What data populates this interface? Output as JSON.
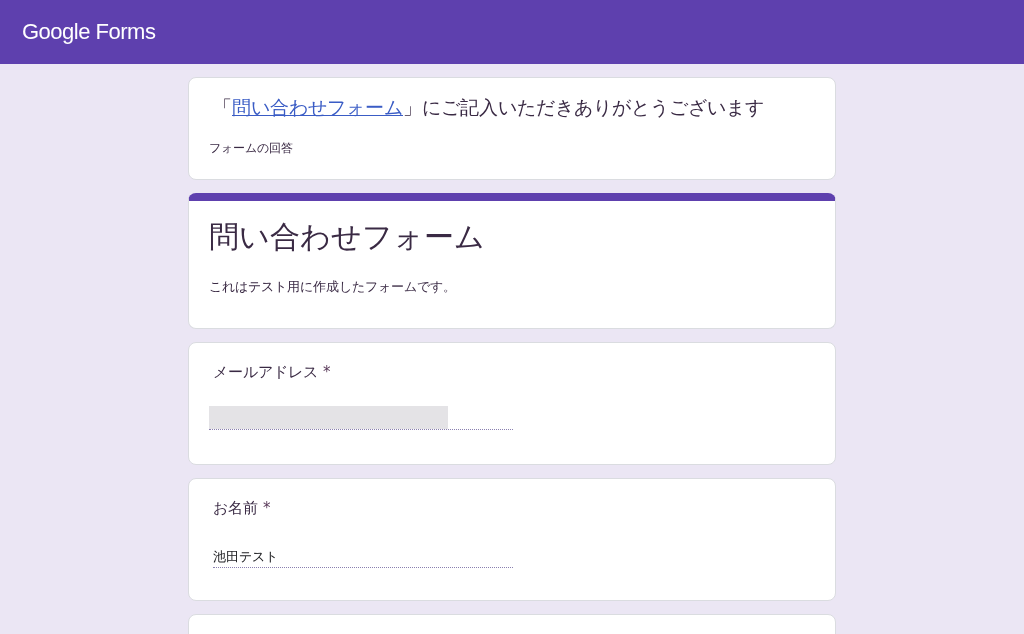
{
  "app_bar": {
    "logo": "Google Forms"
  },
  "confirmation": {
    "title_before": "「",
    "title_link": "問い合わせフォーム",
    "title_after": "」にご記入いただきありがとうございます",
    "subtitle": "フォームの回答"
  },
  "form_header": {
    "title": "問い合わせフォーム",
    "description": "これはテスト用に作成したフォームです。"
  },
  "questions": [
    {
      "label": "メールアドレス",
      "required_mark": "*",
      "value_redacted": true
    },
    {
      "label": "お名前",
      "required_mark": "*",
      "value": "池田テスト",
      "value_redacted": false
    }
  ]
}
